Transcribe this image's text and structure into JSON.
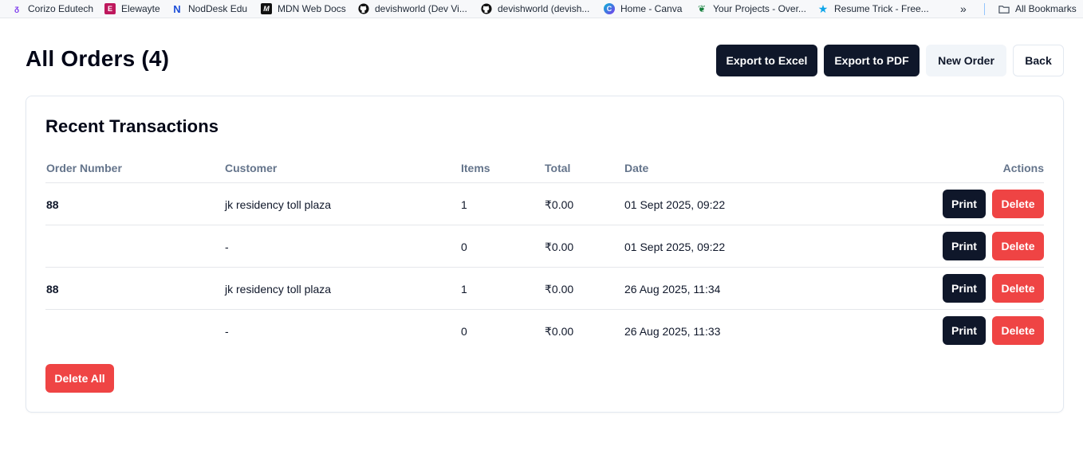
{
  "bookmarks": {
    "items": [
      {
        "label": "Corizo Edutech",
        "icon": "corizo-icon",
        "color": "#7c3aed"
      },
      {
        "label": "Elewayte",
        "icon": "elewayte-icon",
        "color": "#be185d"
      },
      {
        "label": "NodDesk Edu",
        "icon": "noddesk-icon",
        "color": "#1d4ed8"
      },
      {
        "label": "MDN Web Docs",
        "icon": "mdn-icon",
        "color": "#111111"
      },
      {
        "label": "devishworld (Dev Vi...",
        "icon": "github-icon",
        "color": "#111111"
      },
      {
        "label": "devishworld (devish...",
        "icon": "github-icon",
        "color": "#111111"
      },
      {
        "label": "Home - Canva",
        "icon": "canva-icon",
        "color": "#7c3aed"
      },
      {
        "label": "Your Projects - Over...",
        "icon": "overleaf-icon",
        "color": "#15803d"
      },
      {
        "label": "Resume Trick - Free...",
        "icon": "star-icon",
        "color": "#0ea5e9"
      }
    ],
    "overflow": "»",
    "all_bookmarks": "All Bookmarks"
  },
  "header": {
    "title": "All Orders (4)",
    "buttons": {
      "export_excel": "Export to Excel",
      "export_pdf": "Export to PDF",
      "new_order": "New Order",
      "back": "Back"
    }
  },
  "card": {
    "title": "Recent Transactions",
    "columns": {
      "order_number": "Order Number",
      "customer": "Customer",
      "items": "Items",
      "total": "Total",
      "date": "Date",
      "actions": "Actions"
    },
    "rows": [
      {
        "order_number": "88",
        "customer": "jk residency toll plaza",
        "items": "1",
        "total": "₹0.00",
        "date": "01 Sept 2025, 09:22",
        "print": "Print",
        "delete": "Delete"
      },
      {
        "order_number": "",
        "customer": "-",
        "items": "0",
        "total": "₹0.00",
        "date": "01 Sept 2025, 09:22",
        "print": "Print",
        "delete": "Delete"
      },
      {
        "order_number": "88",
        "customer": "jk residency toll plaza",
        "items": "1",
        "total": "₹0.00",
        "date": "26 Aug 2025, 11:34",
        "print": "Print",
        "delete": "Delete"
      },
      {
        "order_number": "",
        "customer": "-",
        "items": "0",
        "total": "₹0.00",
        "date": "26 Aug 2025, 11:33",
        "print": "Print",
        "delete": "Delete"
      }
    ],
    "delete_all": "Delete All"
  },
  "colors": {
    "primary_dark": "#0f172a",
    "danger": "#ef4444",
    "muted": "#64748b"
  }
}
